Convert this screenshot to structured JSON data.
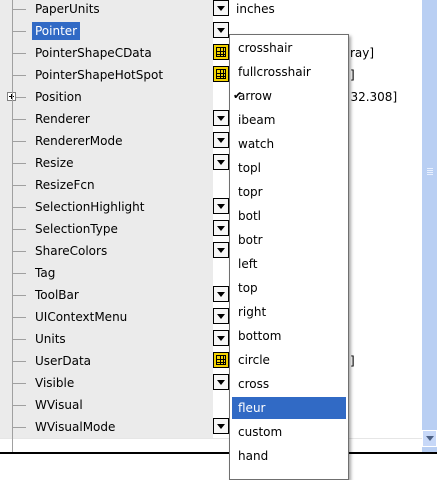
{
  "properties": [
    {
      "name": "PaperUnits",
      "control": "dropdown",
      "value": "inches"
    },
    {
      "name": "Pointer",
      "control": "dropdown",
      "value": "",
      "selected": true
    },
    {
      "name": "PointerShapeCData",
      "control": "grid",
      "value_fragment": "ray]"
    },
    {
      "name": "PointerShapeHotSpot",
      "control": "grid",
      "value_fragment": "]"
    },
    {
      "name": "Position",
      "control": "expander",
      "value_fragment": "2 32.308]"
    },
    {
      "name": "Renderer",
      "control": "dropdown"
    },
    {
      "name": "RendererMode",
      "control": "dropdown"
    },
    {
      "name": "Resize",
      "control": "dropdown"
    },
    {
      "name": "ResizeFcn",
      "control": "none"
    },
    {
      "name": "SelectionHighlight",
      "control": "dropdown"
    },
    {
      "name": "SelectionType",
      "control": "dropdown"
    },
    {
      "name": "ShareColors",
      "control": "dropdown"
    },
    {
      "name": "Tag",
      "control": "none"
    },
    {
      "name": "ToolBar",
      "control": "dropdown"
    },
    {
      "name": "UIContextMenu",
      "control": "dropdown"
    },
    {
      "name": "Units",
      "control": "dropdown"
    },
    {
      "name": "UserData",
      "control": "grid",
      "value_fragment": "]"
    },
    {
      "name": "Visible",
      "control": "dropdown"
    },
    {
      "name": "WVisual",
      "control": "none"
    },
    {
      "name": "WVisualMode",
      "control": "dropdown"
    }
  ],
  "dropdown": {
    "options": [
      {
        "label": "crosshair"
      },
      {
        "label": "fullcrosshair"
      },
      {
        "label": "arrow",
        "checked": true
      },
      {
        "label": "ibeam"
      },
      {
        "label": "watch"
      },
      {
        "label": "topl"
      },
      {
        "label": "topr"
      },
      {
        "label": "botl"
      },
      {
        "label": "botr"
      },
      {
        "label": "left"
      },
      {
        "label": "top"
      },
      {
        "label": "right"
      },
      {
        "label": "bottom"
      },
      {
        "label": "circle"
      },
      {
        "label": "cross"
      },
      {
        "label": "fleur",
        "highlighted": true
      },
      {
        "label": "custom"
      },
      {
        "label": "hand"
      }
    ]
  },
  "colors": {
    "selection": "#316ac5",
    "name_column": "#ebebeb",
    "scrollbar": "#b9cff3"
  }
}
